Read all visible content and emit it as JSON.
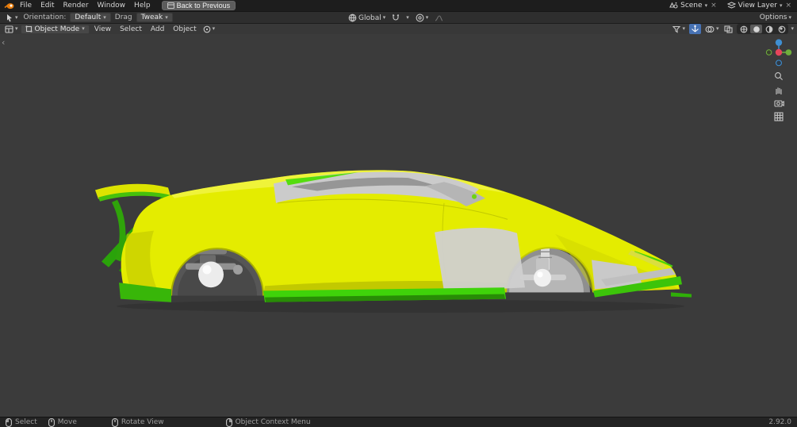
{
  "topbar": {
    "menus": [
      "File",
      "Edit",
      "Render",
      "Window",
      "Help"
    ],
    "back_button": "Back to Previous",
    "scene_label": "Scene",
    "view_layer_label": "View Layer"
  },
  "tool_settings": {
    "orientation_label": "Orientation:",
    "orientation_value": "Default",
    "drag_label": "Drag",
    "drag_value": "Tweak",
    "transform_orientation": "Global",
    "options_label": "Options"
  },
  "viewport": {
    "mode": "Object Mode",
    "menus": [
      "View",
      "Select",
      "Add",
      "Object"
    ]
  },
  "status_bar": {
    "hints": [
      {
        "label": "Select"
      },
      {
        "label": "Move"
      },
      {
        "label": "Rotate View"
      },
      {
        "label": "Object Context Menu"
      }
    ],
    "version": "2.92.0"
  },
  "icons": {
    "dropdown": "▾",
    "close": "×",
    "collapse": "‹"
  },
  "colors": {
    "car_body_yellow": "#e4ec00",
    "car_accent_green": "#3fd30a",
    "car_panel_gray": "#cbcbcb",
    "viewport_background": "#3b3b3b",
    "axis_x": "#e5455b",
    "axis_y": "#6fae3c",
    "axis_z": "#3f8fd2"
  }
}
